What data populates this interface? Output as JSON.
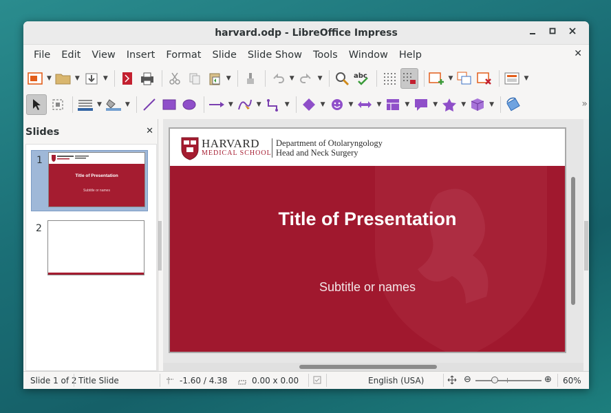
{
  "window": {
    "title": "harvard.odp - LibreOffice Impress",
    "minimize_icon": "minimize-icon",
    "maximize_icon": "maximize-icon",
    "close_icon": "close-icon"
  },
  "menubar": {
    "items": [
      "File",
      "Edit",
      "View",
      "Insert",
      "Format",
      "Slide",
      "Slide Show",
      "Tools",
      "Window",
      "Help"
    ],
    "close_glyph": "✕"
  },
  "slides_pane": {
    "title": "Slides",
    "close_glyph": "✕",
    "slides": [
      {
        "number": "1",
        "title": "Title of Presentation",
        "subtitle": "Subtitle or names",
        "selected": true
      },
      {
        "number": "2",
        "selected": false
      }
    ]
  },
  "slide": {
    "logo_name": "HARVARD",
    "logo_sub": "MEDICAL SCHOOL",
    "dept_line1": "Department of Otolaryngology",
    "dept_line2": "Head and Neck Surgery",
    "title": "Title of Presentation",
    "subtitle": "Subtitle or names",
    "colors": {
      "crimson": "#a0182e",
      "header_bg": "#ffffff"
    }
  },
  "statusbar": {
    "slide_position": "Slide 1 of 2",
    "layout": "Title Slide",
    "cursor_position": "-1.60 / 4.38",
    "object_size": "0.00 x 0.00",
    "language": "English (USA)",
    "zoom": "60%",
    "zoom_minus": "⊖",
    "zoom_plus": "⊕"
  },
  "colors": {
    "accent": "#a51c30",
    "desktop": "#1b6f76"
  }
}
